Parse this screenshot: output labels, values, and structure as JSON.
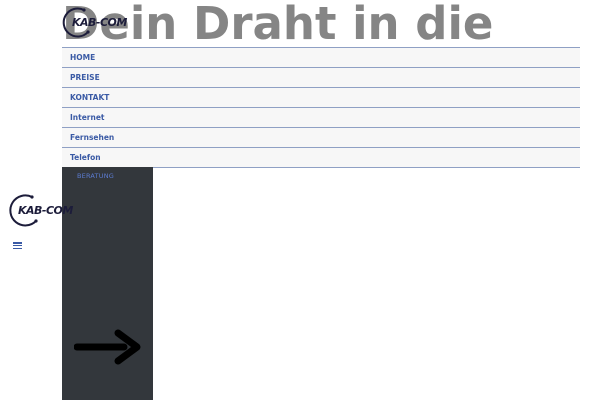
{
  "header": {
    "title": "Dein Draht in die"
  },
  "logo": {
    "text": "KAB-COM"
  },
  "nav": {
    "items": [
      {
        "label": "HOME"
      },
      {
        "label": "PREISE"
      },
      {
        "label": "KONTAKT"
      },
      {
        "label": "Internet"
      },
      {
        "label": "Fernsehen"
      },
      {
        "label": "Telefon"
      }
    ]
  },
  "submenu": {
    "label": "BERATUNG"
  },
  "icons": {
    "menu": "hamburger-icon",
    "arrow": "arrow-right-icon",
    "logo": "kabcom-logo-icon"
  },
  "colors": {
    "nav_text": "#3a5aa5",
    "panel_bg": "#33373c",
    "title": "#858585"
  }
}
